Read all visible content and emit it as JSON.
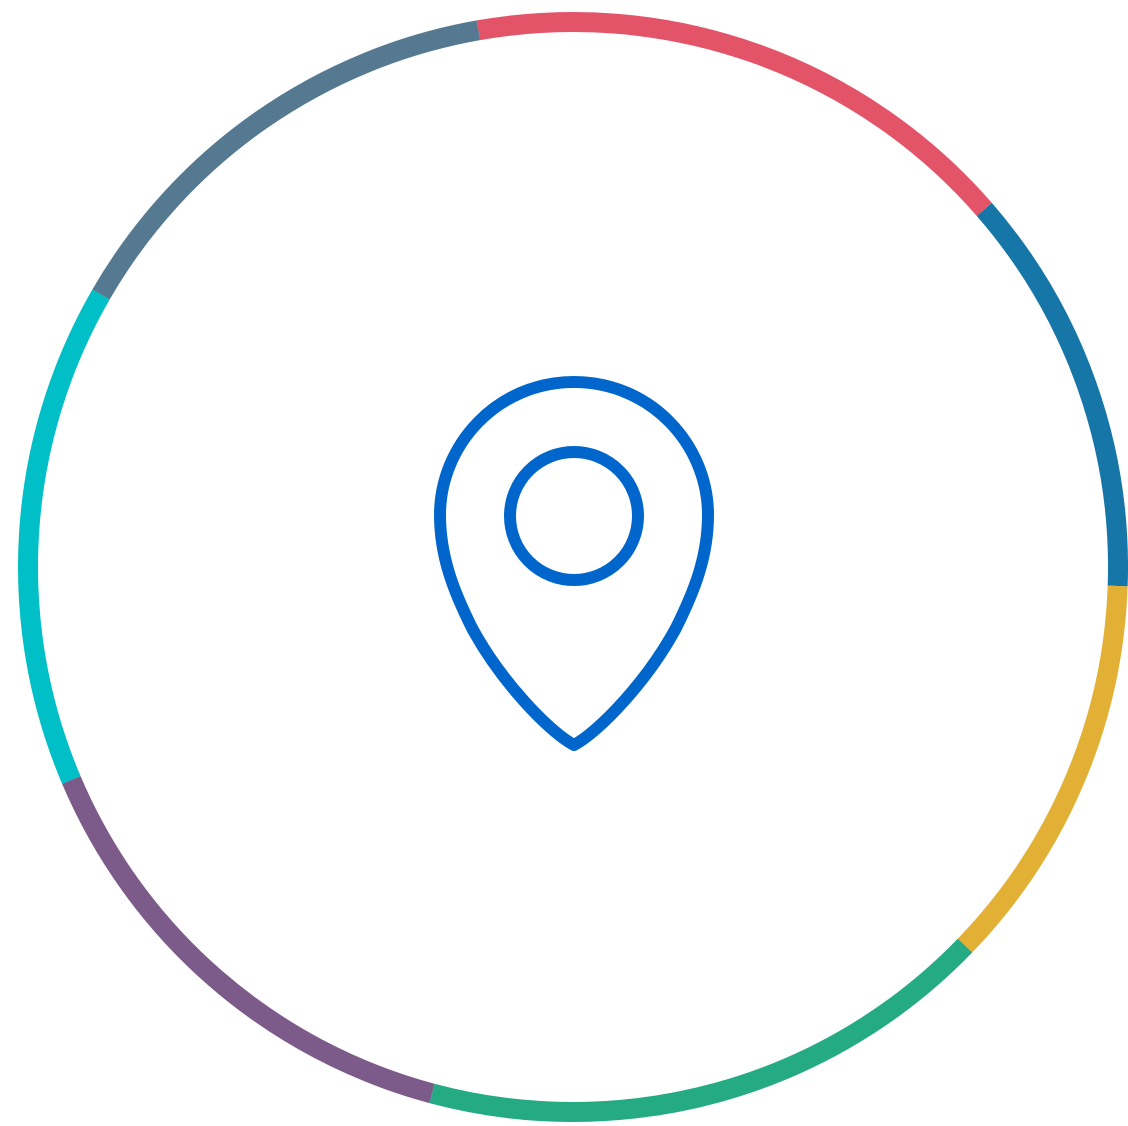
{
  "graphic": {
    "icon": "map-pin-icon",
    "icon_color": "#0066CC",
    "ring_segments": [
      {
        "name": "ring-segment-red",
        "color": "#E35469"
      },
      {
        "name": "ring-segment-blue",
        "color": "#1676A8"
      },
      {
        "name": "ring-segment-yellow",
        "color": "#E2B035"
      },
      {
        "name": "ring-segment-green",
        "color": "#25AB83"
      },
      {
        "name": "ring-segment-purple",
        "color": "#7C5A89"
      },
      {
        "name": "ring-segment-cyan",
        "color": "#00BFC7"
      },
      {
        "name": "ring-segment-slate",
        "color": "#557991"
      }
    ]
  }
}
